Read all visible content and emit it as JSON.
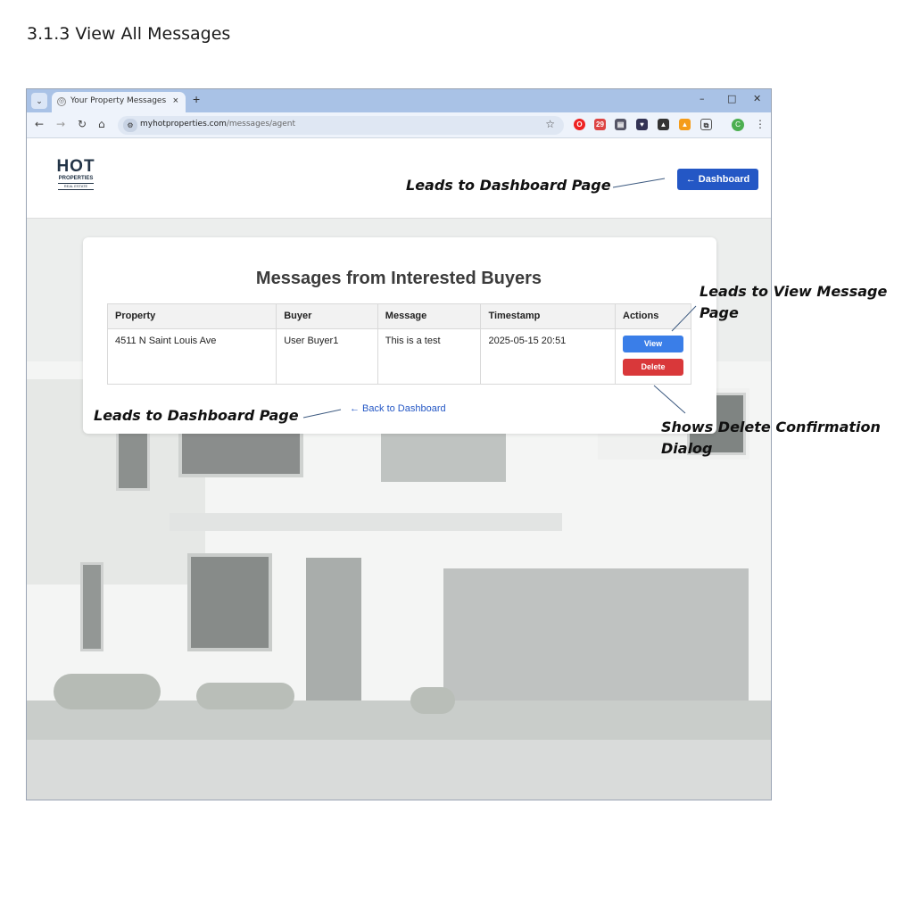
{
  "document": {
    "heading": "3.1.3 View All Messages"
  },
  "browser": {
    "tab_title": "Your Property Messages",
    "url_host": "myhotproperties.com",
    "url_path": "/messages/agent",
    "extension_badge": "29",
    "profile_initial": "C"
  },
  "site": {
    "logo_top": "HOT",
    "logo_mid": "PROPERTIES",
    "logo_bottom": "REAL ESTATE",
    "dashboard_button": "← Dashboard",
    "title": "Messages from Interested Buyers",
    "columns": [
      "Property",
      "Buyer",
      "Message",
      "Timestamp",
      "Actions"
    ],
    "rows": [
      {
        "property": "4511 N Saint Louis Ave",
        "buyer": "User Buyer1",
        "message": "This is a test",
        "timestamp": "2025-05-15 20:51",
        "view_label": "View",
        "delete_label": "Delete"
      }
    ],
    "back_link": "← Back to Dashboard"
  },
  "annotations": {
    "header_dashboard": "Leads to Dashboard Page",
    "view_message": "Leads to View Message Page",
    "back_dashboard": "Leads to Dashboard Page",
    "delete_dialog": "Shows Delete Confirmation Dialog"
  }
}
